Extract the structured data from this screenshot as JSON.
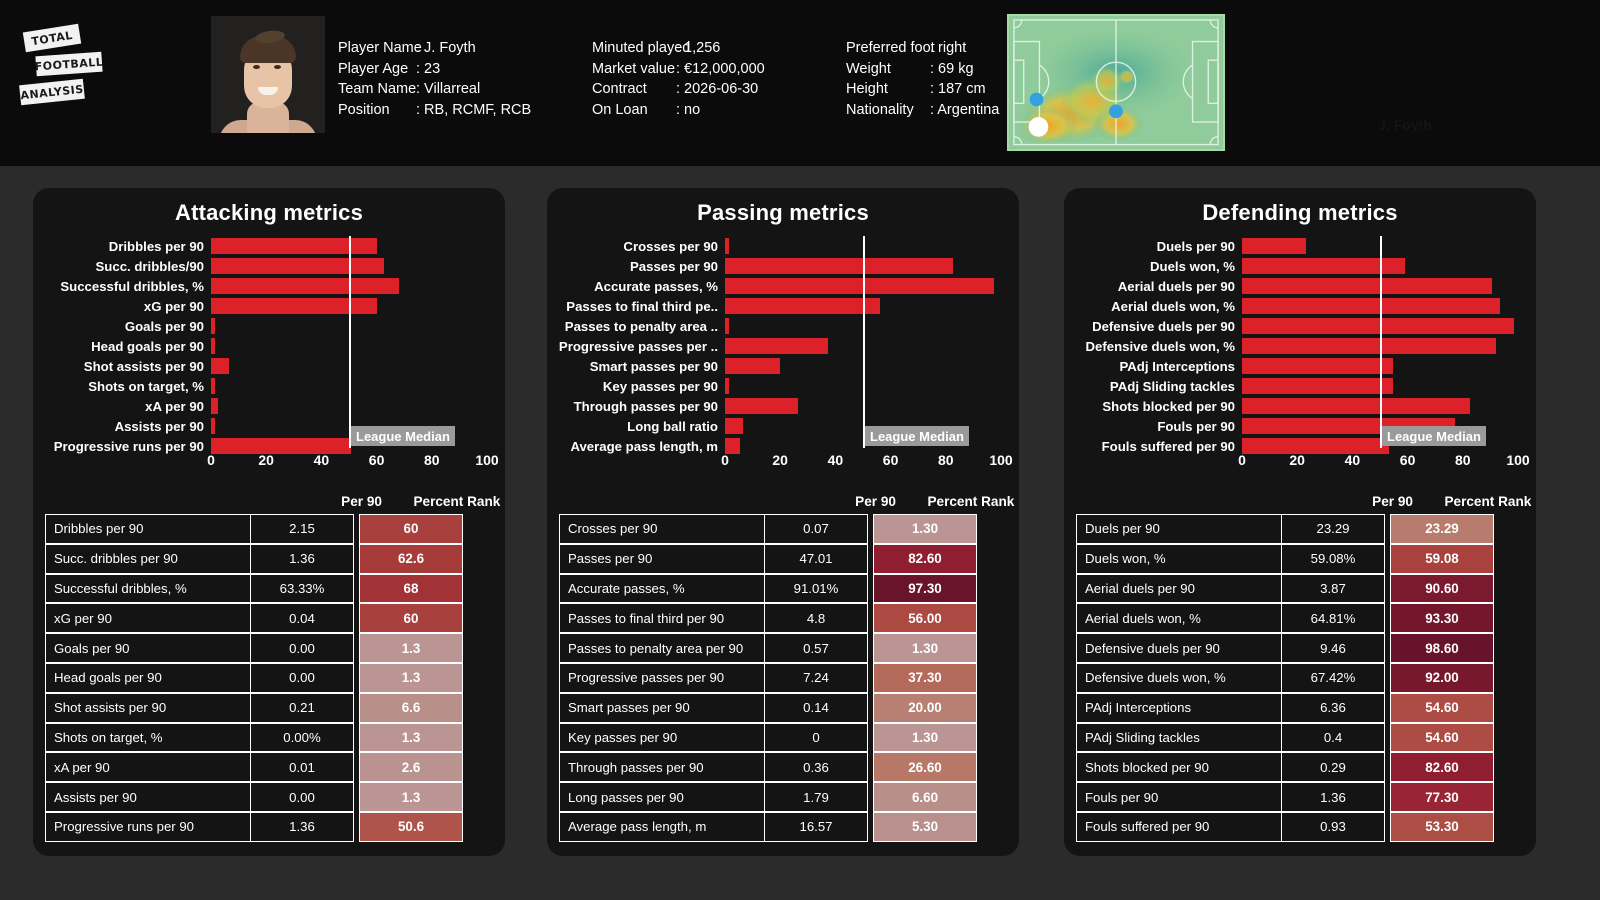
{
  "brand": {
    "line1": "TOTAL",
    "line2": "FOOTBALL",
    "line3": "ANALYSIS"
  },
  "player": {
    "ghost_name": "J. Foyth",
    "col1": [
      {
        "key": "Player Name",
        "value": ": J. Foyth"
      },
      {
        "key": "Player Age",
        "value": ": 23"
      },
      {
        "key": "Team Name",
        "value": ": Villarreal"
      },
      {
        "key": "Position",
        "value": ": RB, RCMF, RCB"
      }
    ],
    "col2": [
      {
        "key": "Minuted played",
        "value": ": 1,256"
      },
      {
        "key": "Market value",
        "value": ": €12,000,000"
      },
      {
        "key": "Contract",
        "value": ": 2026-06-30"
      },
      {
        "key": "On Loan",
        "value": ": no"
      }
    ],
    "col3": [
      {
        "key": "Preferred foot",
        "value": ": right"
      },
      {
        "key": "Weight",
        "value": ": 69 kg"
      },
      {
        "key": "Height",
        "value": ": 187 cm"
      },
      {
        "key": "Nationality",
        "value": ": Argentina"
      }
    ]
  },
  "colors": {
    "bar_red": "#dc2128",
    "panel_bg": "#141414",
    "page_bg": "#2b2b2b",
    "median_line": "#ffffff",
    "median_tag_bg": "#9a9a9a"
  },
  "axis": {
    "ticks": [
      "0",
      "20",
      "40",
      "60",
      "80",
      "100"
    ],
    "min": 0,
    "max": 100
  },
  "median_label": "League Median",
  "median_value": 50,
  "table_headers": {
    "metric": "",
    "per90": "Per 90",
    "percent_rank": "Percent Rank"
  },
  "chart_data": [
    {
      "type": "bar",
      "title": "Attacking metrics",
      "xlabel": "",
      "ylabel": "",
      "xlim": [
        0,
        100
      ],
      "orientation": "horizontal",
      "grid": false,
      "annotations": [
        {
          "label": "League Median",
          "x": 50
        }
      ],
      "categories": [
        "Dribbles per 90",
        "Succ. dribbles/90",
        "Successful dribbles, %",
        "xG per 90",
        "Goals per 90",
        "Head goals per 90",
        "Shot assists per 90",
        "Shots on target, %",
        "xA per 90",
        "Assists per 90",
        "Progressive runs per 90"
      ],
      "values": [
        60,
        62.6,
        68,
        60,
        1.3,
        1.3,
        6.6,
        1.3,
        2.6,
        1.3,
        50.6
      ],
      "table": {
        "columns": [
          "",
          "Per 90",
          "Percent Rank"
        ],
        "rows": [
          {
            "metric": "Dribbles per 90",
            "per90": "2.15",
            "rank": "60",
            "rank_value": 60
          },
          {
            "metric": "Succ. dribbles per 90",
            "per90": "1.36",
            "rank": "62.6",
            "rank_value": 62.6
          },
          {
            "metric": "Successful dribbles, %",
            "per90": "63.33%",
            "rank": "68",
            "rank_value": 68
          },
          {
            "metric": "xG per 90",
            "per90": "0.04",
            "rank": "60",
            "rank_value": 60
          },
          {
            "metric": "Goals per 90",
            "per90": "0.00",
            "rank": "1.3",
            "rank_value": 1.3
          },
          {
            "metric": "Head goals per 90",
            "per90": "0.00",
            "rank": "1.3",
            "rank_value": 1.3
          },
          {
            "metric": "Shot assists per 90",
            "per90": "0.21",
            "rank": "6.6",
            "rank_value": 6.6
          },
          {
            "metric": "Shots on target, %",
            "per90": "0.00%",
            "rank": "1.3",
            "rank_value": 1.3
          },
          {
            "metric": "xA per 90",
            "per90": "0.01",
            "rank": "2.6",
            "rank_value": 2.6
          },
          {
            "metric": "Assists per 90",
            "per90": "0.00",
            "rank": "1.3",
            "rank_value": 1.3
          },
          {
            "metric": "Progressive runs per 90",
            "per90": "1.36",
            "rank": "50.6",
            "rank_value": 50.6
          }
        ]
      }
    },
    {
      "type": "bar",
      "title": "Passing metrics",
      "xlabel": "",
      "ylabel": "",
      "xlim": [
        0,
        100
      ],
      "orientation": "horizontal",
      "grid": false,
      "annotations": [
        {
          "label": "League Median",
          "x": 50
        }
      ],
      "categories": [
        "Crosses per 90",
        "Passes per 90",
        "Accurate passes, %",
        "Passes to final third pe..",
        "Passes to penalty area ..",
        "Progressive passes per ..",
        "Smart passes per 90",
        "Key passes per 90",
        "Through passes per 90",
        "Long ball ratio",
        "Average pass length, m"
      ],
      "values": [
        1.3,
        82.6,
        97.3,
        56.0,
        1.3,
        37.3,
        20.0,
        1.3,
        26.6,
        6.6,
        5.3
      ],
      "table": {
        "columns": [
          "",
          "Per 90",
          "Percent Rank"
        ],
        "rows": [
          {
            "metric": "Crosses per 90",
            "per90": "0.07",
            "rank": "1.30",
            "rank_value": 1.3
          },
          {
            "metric": "Passes per 90",
            "per90": "47.01",
            "rank": "82.60",
            "rank_value": 82.6
          },
          {
            "metric": "Accurate passes, %",
            "per90": "91.01%",
            "rank": "97.30",
            "rank_value": 97.3
          },
          {
            "metric": "Passes to final third per 90",
            "per90": "4.8",
            "rank": "56.00",
            "rank_value": 56.0
          },
          {
            "metric": "Passes to penalty area per 90",
            "per90": "0.57",
            "rank": "1.30",
            "rank_value": 1.3
          },
          {
            "metric": "Progressive passes per 90",
            "per90": "7.24",
            "rank": "37.30",
            "rank_value": 37.3
          },
          {
            "metric": "Smart passes per 90",
            "per90": "0.14",
            "rank": "20.00",
            "rank_value": 20.0
          },
          {
            "metric": "Key passes per 90",
            "per90": "0",
            "rank": "1.30",
            "rank_value": 1.3
          },
          {
            "metric": "Through passes per 90",
            "per90": "0.36",
            "rank": "26.60",
            "rank_value": 26.6
          },
          {
            "metric": "Long passes per 90",
            "per90": "1.79",
            "rank": "6.60",
            "rank_value": 6.6
          },
          {
            "metric": "Average pass length, m",
            "per90": "16.57",
            "rank": "5.30",
            "rank_value": 5.3
          }
        ]
      }
    },
    {
      "type": "bar",
      "title": "Defending metrics",
      "xlabel": "",
      "ylabel": "",
      "xlim": [
        0,
        100
      ],
      "orientation": "horizontal",
      "grid": false,
      "annotations": [
        {
          "label": "League Median",
          "x": 50
        }
      ],
      "categories": [
        "Duels per 90",
        "Duels won, %",
        "Aerial duels per 90",
        "Aerial duels won, %",
        "Defensive duels per 90",
        "Defensive duels won, %",
        "PAdj Interceptions",
        "PAdj Sliding tackles",
        "Shots blocked per 90",
        "Fouls per 90",
        "Fouls suffered per 90"
      ],
      "values": [
        23.29,
        59.08,
        90.6,
        93.3,
        98.6,
        92.0,
        54.6,
        54.6,
        82.6,
        77.3,
        53.3
      ],
      "table": {
        "columns": [
          "",
          "Per 90",
          "Percent Rank"
        ],
        "rows": [
          {
            "metric": "Duels per 90",
            "per90": "23.29",
            "rank": "23.29",
            "rank_value": 23.29
          },
          {
            "metric": "Duels won, %",
            "per90": "59.08%",
            "rank": "59.08",
            "rank_value": 59.08
          },
          {
            "metric": "Aerial duels per 90",
            "per90": "3.87",
            "rank": "90.60",
            "rank_value": 90.6
          },
          {
            "metric": "Aerial duels won, %",
            "per90": "64.81%",
            "rank": "93.30",
            "rank_value": 93.3
          },
          {
            "metric": "Defensive duels per 90",
            "per90": "9.46",
            "rank": "98.60",
            "rank_value": 98.6
          },
          {
            "metric": "Defensive duels won, %",
            "per90": "67.42%",
            "rank": "92.00",
            "rank_value": 92.0
          },
          {
            "metric": "PAdj Interceptions",
            "per90": "6.36",
            "rank": "54.60",
            "rank_value": 54.6
          },
          {
            "metric": "PAdj Sliding tackles",
            "per90": "0.4",
            "rank": "54.60",
            "rank_value": 54.6
          },
          {
            "metric": "Shots blocked per 90",
            "per90": "0.29",
            "rank": "82.60",
            "rank_value": 82.6
          },
          {
            "metric": "Fouls per 90",
            "per90": "1.36",
            "rank": "77.30",
            "rank_value": 77.3
          },
          {
            "metric": "Fouls suffered per 90",
            "per90": "0.93",
            "rank": "53.30",
            "rank_value": 53.3
          }
        ]
      }
    }
  ]
}
